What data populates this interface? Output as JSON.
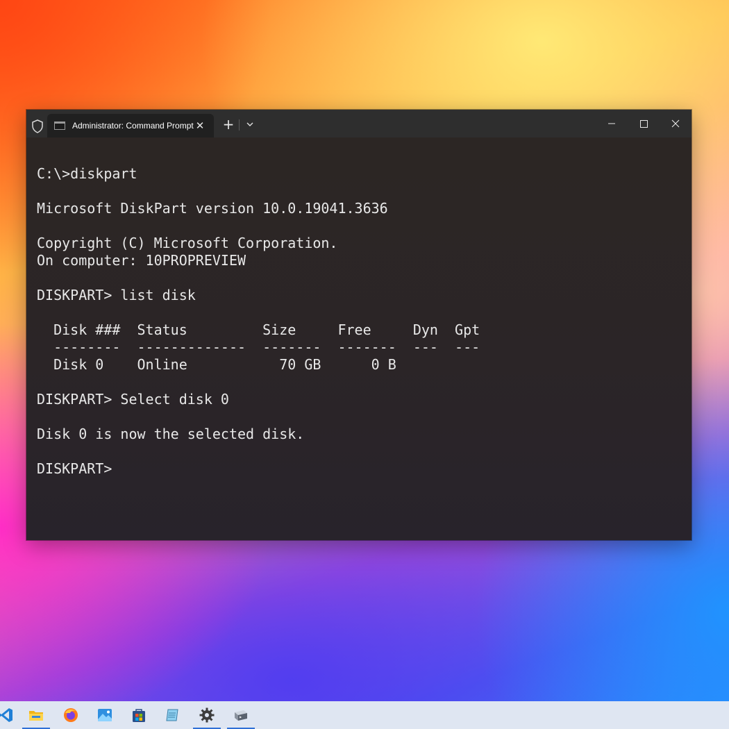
{
  "window": {
    "tab_title": "Administrator: Command Prompt",
    "close_glyph": "✕",
    "new_tab_glyph": "+"
  },
  "console": {
    "lines": [
      "C:\\>diskpart",
      "",
      "Microsoft DiskPart version 10.0.19041.3636",
      "",
      "Copyright (C) Microsoft Corporation.",
      "On computer: 10PROPREVIEW",
      "",
      "DISKPART> list disk",
      "",
      "  Disk ###  Status         Size     Free     Dyn  Gpt",
      "  --------  -------------  -------  -------  ---  ---",
      "  Disk 0    Online           70 GB      0 B",
      "",
      "DISKPART> Select disk 0",
      "",
      "Disk 0 is now the selected disk.",
      "",
      "DISKPART>"
    ]
  },
  "taskbar": {
    "items": [
      {
        "name": "vscode-icon",
        "active": false
      },
      {
        "name": "file-explorer-icon",
        "active": true
      },
      {
        "name": "firefox-icon",
        "active": false
      },
      {
        "name": "photos-icon",
        "active": false
      },
      {
        "name": "microsoft-store-icon",
        "active": false
      },
      {
        "name": "notepad-icon",
        "active": false
      },
      {
        "name": "settings-icon",
        "active": true
      },
      {
        "name": "terminal-icon",
        "active": true
      }
    ]
  },
  "colors": {
    "console_text": "#e8e8e8",
    "console_bg": "#2a2628",
    "titlebar_bg": "#2e2e2e",
    "taskbar_bg": "#dfe6f2",
    "taskbar_active": "#2f6fd6"
  }
}
